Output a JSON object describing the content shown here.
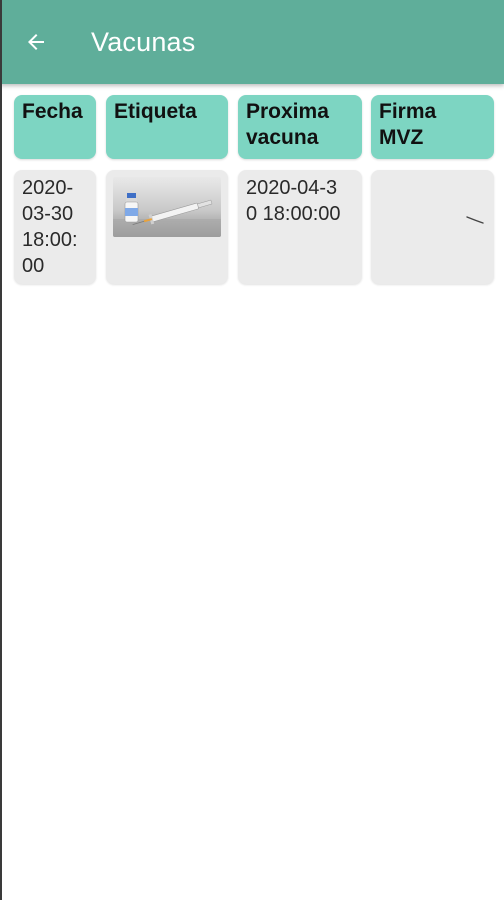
{
  "appbar": {
    "title": "Vacunas",
    "back_icon": "arrow-left-icon",
    "background_color": "#5fae9a"
  },
  "table": {
    "header_color": "#7dd5c2",
    "cell_color": "#ebebeb",
    "columns": [
      "Fecha",
      "Etiqueta",
      "Proxima vacuna",
      "Firma MVZ"
    ],
    "rows": [
      {
        "fecha": "2020-03-30 18:00:00",
        "etiqueta_image": "vaccine-vial-and-syringe-photo",
        "proxima_vacuna": "2020-04-30 18:00:00",
        "firma_image": "signature-stroke"
      }
    ]
  }
}
